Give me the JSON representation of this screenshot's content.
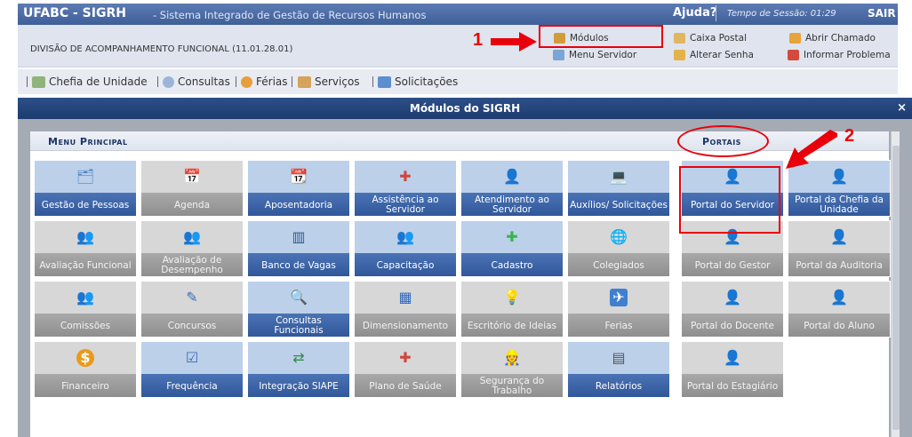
{
  "header": {
    "title": "UFABC - SIGRH",
    "subtitle": "- Sistema Integrado de Gestão de Recursos Humanos",
    "help": "Ajuda?",
    "session": "Tempo de Sessão: 01:29",
    "logout": "SAIR"
  },
  "infobar": {
    "division": "DIVISÃO DE ACOMPANHAMENTO FUNCIONAL (11.01.28.01)",
    "links": {
      "modulos": "Módulos",
      "caixa_postal": "Caixa Postal",
      "abrir_chamado": "Abrir Chamado",
      "menu_servidor": "Menu Servidor",
      "alterar_senha": "Alterar Senha",
      "informar_problema": "Informar Problema"
    }
  },
  "menubar": {
    "items": [
      "Chefia de Unidade",
      "Consultas",
      "Férias",
      "Serviços",
      "Solicitações"
    ]
  },
  "modal": {
    "title": "Módulos do SIGRH",
    "close": "×",
    "menu_principal": "Menu Principal",
    "portais": "Portais"
  },
  "modules": [
    {
      "label": "Gestão de Pessoas",
      "icon": "people-folder-icon",
      "active": true
    },
    {
      "label": "Agenda",
      "icon": "calendar-icon",
      "active": false
    },
    {
      "label": "Aposentadoria",
      "icon": "calendar-retirement-icon",
      "active": true
    },
    {
      "label": "Assistência ao Servidor",
      "icon": "first-aid-icon",
      "active": true
    },
    {
      "label": "Atendimento ao Servidor",
      "icon": "attendant-icon",
      "active": true
    },
    {
      "label": "Auxílios/ Solicitações",
      "icon": "computer-icon",
      "active": true
    },
    {
      "label": "Avaliação Funcional",
      "icon": "users-icon",
      "active": false
    },
    {
      "label": "Avaliação de Desempenho",
      "icon": "users-check-icon",
      "active": false
    },
    {
      "label": "Banco de Vagas",
      "icon": "database-icon",
      "active": true
    },
    {
      "label": "Capacitação",
      "icon": "group-icon",
      "active": true
    },
    {
      "label": "Cadastro",
      "icon": "plus-icon",
      "active": true
    },
    {
      "label": "Colegiados",
      "icon": "globe-icon",
      "active": false
    },
    {
      "label": "Comissões",
      "icon": "committee-icon",
      "active": false
    },
    {
      "label": "Concursos",
      "icon": "edit-document-icon",
      "active": false
    },
    {
      "label": "Consultas Funcionais",
      "icon": "magnifier-icon",
      "active": true
    },
    {
      "label": "Dimensionamento",
      "icon": "blocks-icon",
      "active": false
    },
    {
      "label": "Escritório de Ideias",
      "icon": "lightbulb-icon",
      "active": false
    },
    {
      "label": "Ferias",
      "icon": "airplane-icon",
      "active": false
    },
    {
      "label": "Financeiro",
      "icon": "coin-icon",
      "active": false
    },
    {
      "label": "Frequência",
      "icon": "checklist-icon",
      "active": true
    },
    {
      "label": "Integração SIAPE",
      "icon": "sync-icon",
      "active": true
    },
    {
      "label": "Plano de Saúde",
      "icon": "health-cross-icon",
      "active": false
    },
    {
      "label": "Segurança do Trabalho",
      "icon": "worker-icon",
      "active": false
    },
    {
      "label": "Relatórios",
      "icon": "report-icon",
      "active": true
    }
  ],
  "portals": [
    {
      "label": "Portal do Servidor",
      "active": true
    },
    {
      "label": "Portal da Chefia da Unidade",
      "active": true
    },
    {
      "label": "Portal do Gestor",
      "active": false
    },
    {
      "label": "Portal da Auditoria",
      "active": false
    },
    {
      "label": "Portal do Docente",
      "active": false
    },
    {
      "label": "Portal do Aluno",
      "active": false
    },
    {
      "label": "Portal do Estagiário",
      "active": false
    }
  ],
  "annotations": {
    "step1": "1",
    "step2": "2"
  },
  "colors": {
    "annotation": "#e8000b",
    "header": "#3f5f99",
    "tile_active": "#2f5597",
    "tile_inactive": "#8c8c8c"
  }
}
